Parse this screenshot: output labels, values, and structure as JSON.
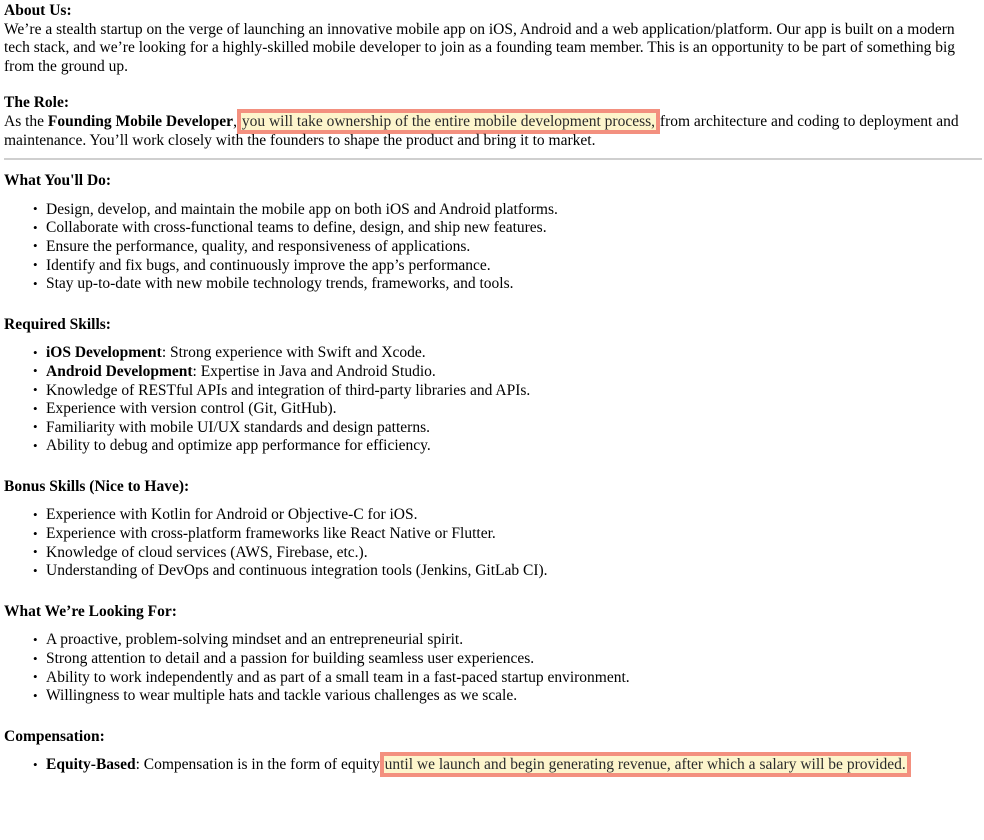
{
  "document": {
    "sections": [
      {
        "id": "about-us",
        "heading": "About Us:",
        "paragraph": "We’re a stealth startup on the verge of launching an innovative mobile app on iOS, Android and a web application/platform. Our app is built on a modern tech stack, and we’re looking for a highly-skilled mobile developer to join as a founding team member. This is an opportunity to be part of something big from the ground up."
      },
      {
        "id": "the-role",
        "heading": "The Role:",
        "paragraph_lead": "As the ",
        "paragraph_bold": "Founding Mobile Developer",
        "paragraph_mid": ", ",
        "paragraph_highlight": "you will take ownership of the entire mobile development process,",
        "paragraph_tail": " from architecture and coding to deployment and maintenance. You’ll work closely with the founders to shape the product and bring it to market."
      },
      {
        "id": "what-youll-do",
        "heading": "What You'll Do:",
        "bullets": [
          "Design, develop, and maintain the mobile app on both iOS and Android platforms.",
          "Collaborate with cross-functional teams to define, design, and ship new features.",
          "Ensure the performance, quality, and responsiveness of applications.",
          "Identify and fix bugs, and continuously improve the app’s performance.",
          "Stay up-to-date with new mobile technology trends, frameworks, and tools."
        ]
      },
      {
        "id": "required-skills",
        "heading": "Required Skills:",
        "bullets": [
          {
            "bold": "iOS Development",
            "text": ": Strong experience with Swift and Xcode."
          },
          {
            "bold": "Android Development",
            "text": ": Expertise in Java and Android Studio."
          },
          {
            "bold": "",
            "text": "Knowledge of RESTful APIs and integration of third-party libraries and APIs."
          },
          {
            "bold": "",
            "text": "Experience with version control (Git, GitHub)."
          },
          {
            "bold": "",
            "text": "Familiarity with mobile UI/UX standards and design patterns."
          },
          {
            "bold": "",
            "text": "Ability to debug and optimize app performance for efficiency."
          }
        ]
      },
      {
        "id": "bonus-skills",
        "heading": "Bonus Skills (Nice to Have):",
        "bullets": [
          "Experience with Kotlin for Android or Objective-C for iOS.",
          "Experience with cross-platform frameworks like React Native or Flutter.",
          "Knowledge of cloud services (AWS, Firebase, etc.).",
          "Understanding of DevOps and continuous integration tools (Jenkins, GitLab CI)."
        ]
      },
      {
        "id": "what-were-looking-for",
        "heading": "What We’re Looking For:",
        "bullets": [
          "A proactive, problem-solving mindset and an entrepreneurial spirit.",
          "Strong attention to detail and a passion for building seamless user experiences.",
          "Ability to work independently and as part of a small team in a fast-paced startup environment.",
          "Willingness to wear multiple hats and tackle various challenges as we scale."
        ]
      },
      {
        "id": "compensation",
        "heading": "Compensation:",
        "bullet_bold": "Equity-Based",
        "bullet_text": ": Compensation is in the form of equity ",
        "bullet_highlight": "until we launch and begin generating revenue, after which a salary will be provided."
      }
    ]
  },
  "colors": {
    "highlight_fill": "#fdf5cc",
    "highlight_border": "#f3907f",
    "rule": "#cfcfcf",
    "text": "#000000"
  }
}
